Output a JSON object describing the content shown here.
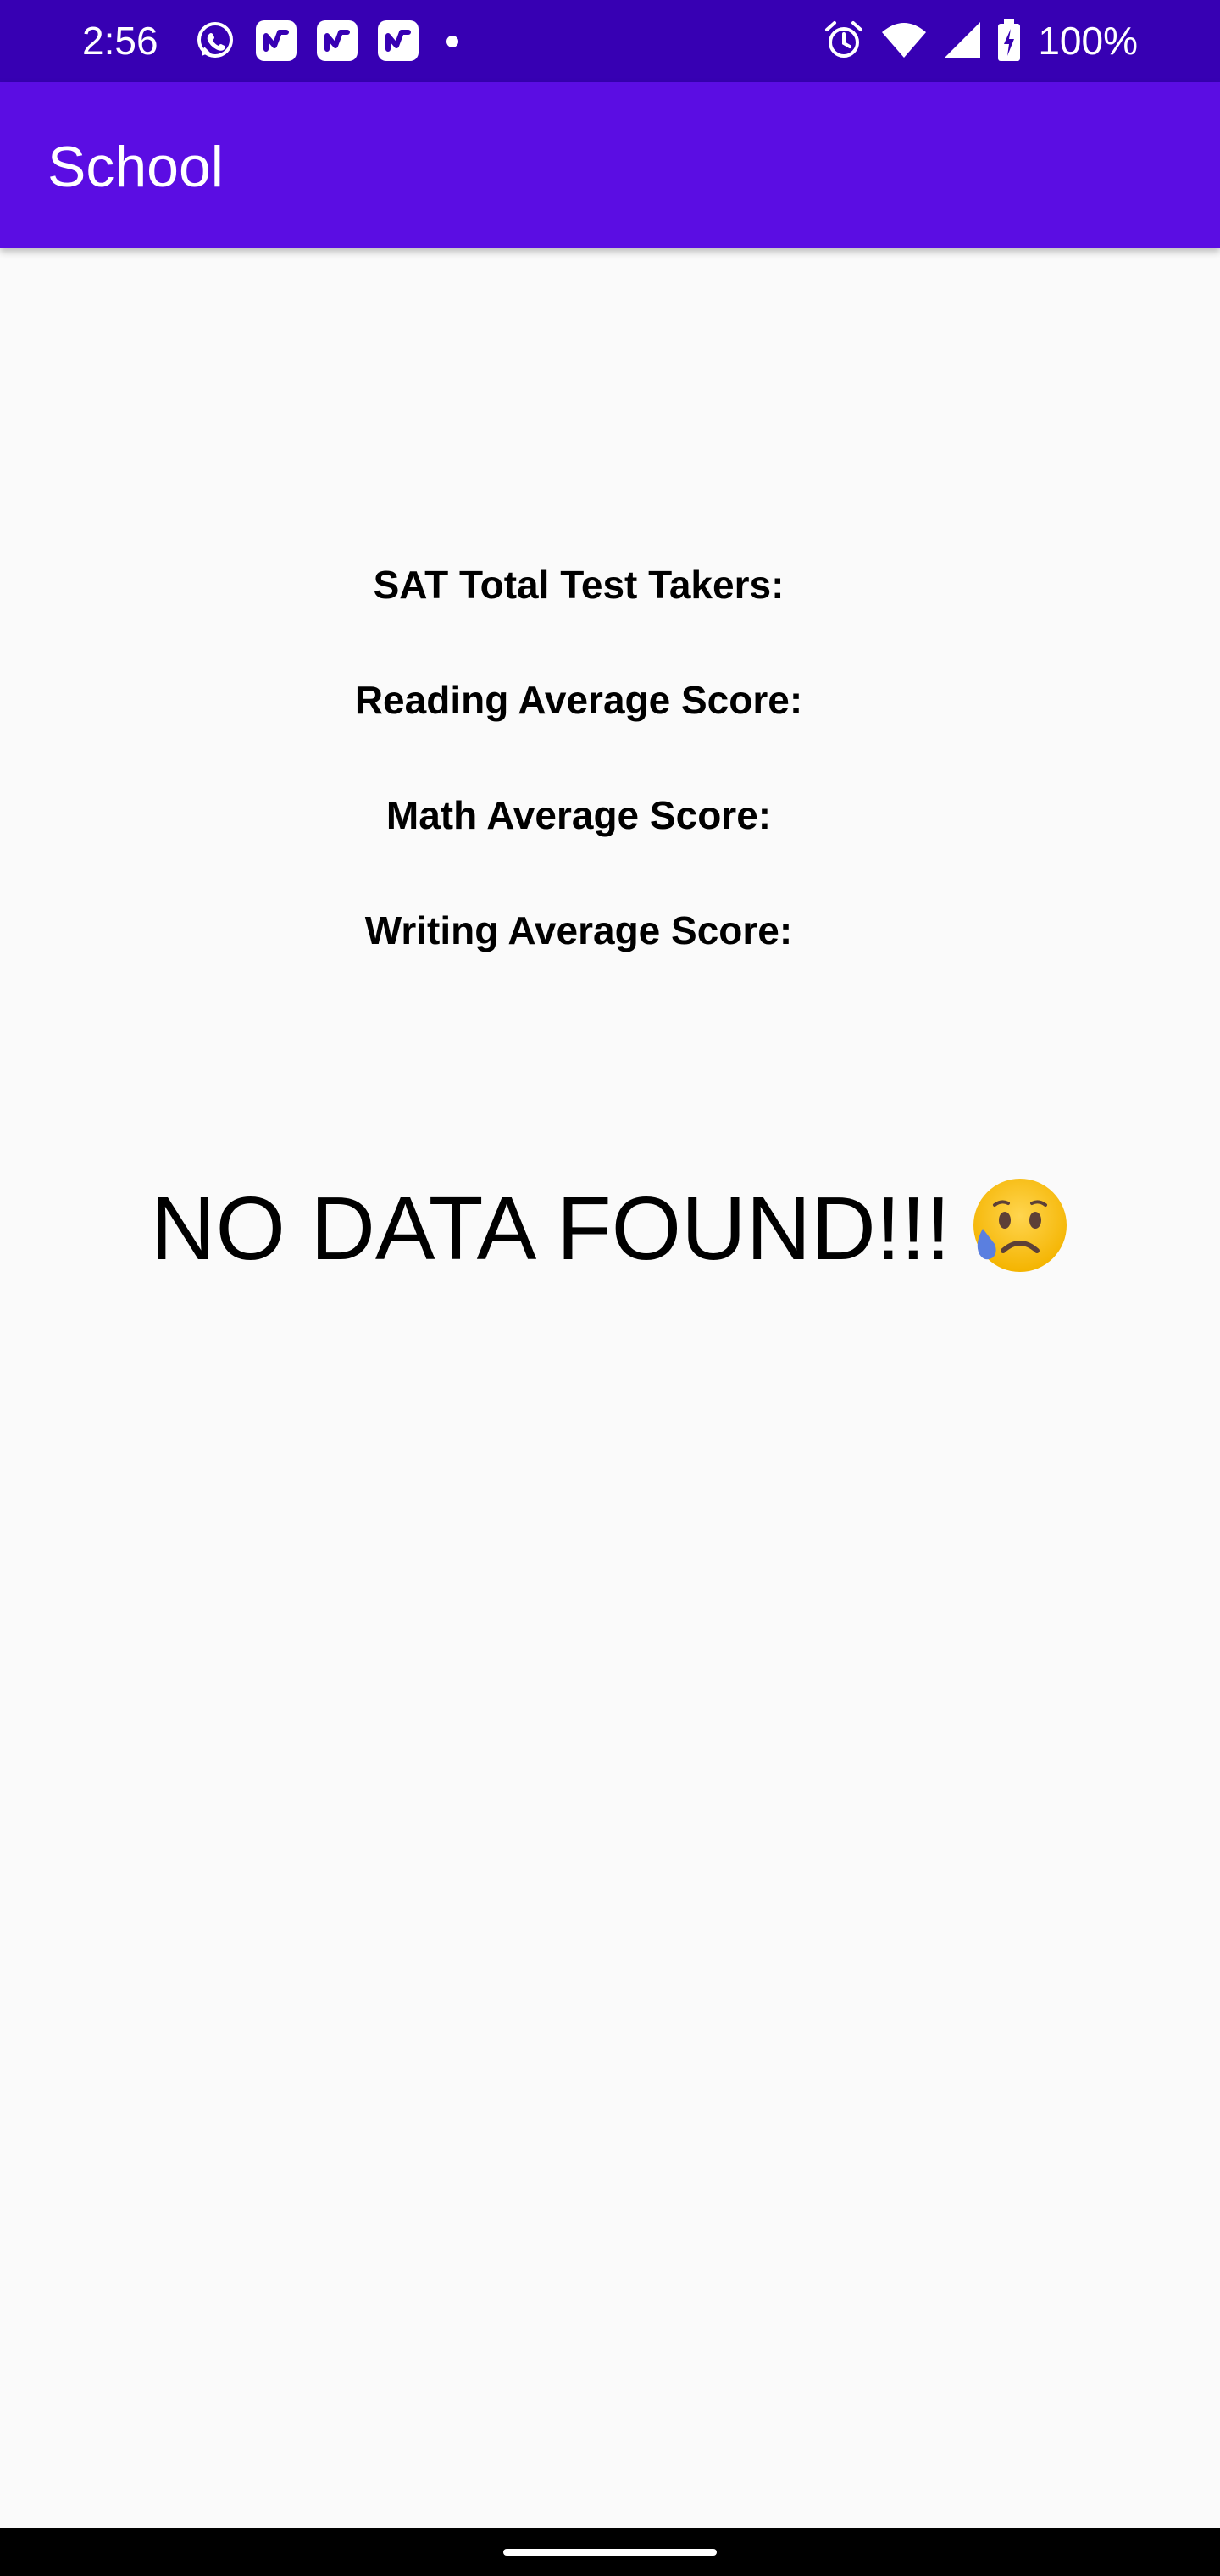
{
  "status_bar": {
    "time": "2:56",
    "battery_percent": "100%",
    "notification_icons": [
      "whatsapp-icon",
      "app-notification-icon",
      "app-notification-icon",
      "app-notification-icon",
      "more-dot-icon"
    ],
    "system_icons": [
      "alarm-icon",
      "wifi-icon",
      "cell-signal-icon",
      "battery-charging-icon"
    ],
    "background_color": "#3700b3"
  },
  "app_bar": {
    "title": "School",
    "background_color": "#5b0de3"
  },
  "main": {
    "labels": {
      "sat_total_test_takers": "SAT Total Test Takers:",
      "reading_average_score": "Reading Average Score:",
      "math_average_score": "Math Average Score:",
      "writing_average_score": "Writing Average Score:"
    },
    "empty_message": "NO DATA FOUND!!!",
    "empty_icon": "sad-sweat-face-icon"
  },
  "nav_bar": {
    "handle_icon": "home-gesture-handle"
  }
}
